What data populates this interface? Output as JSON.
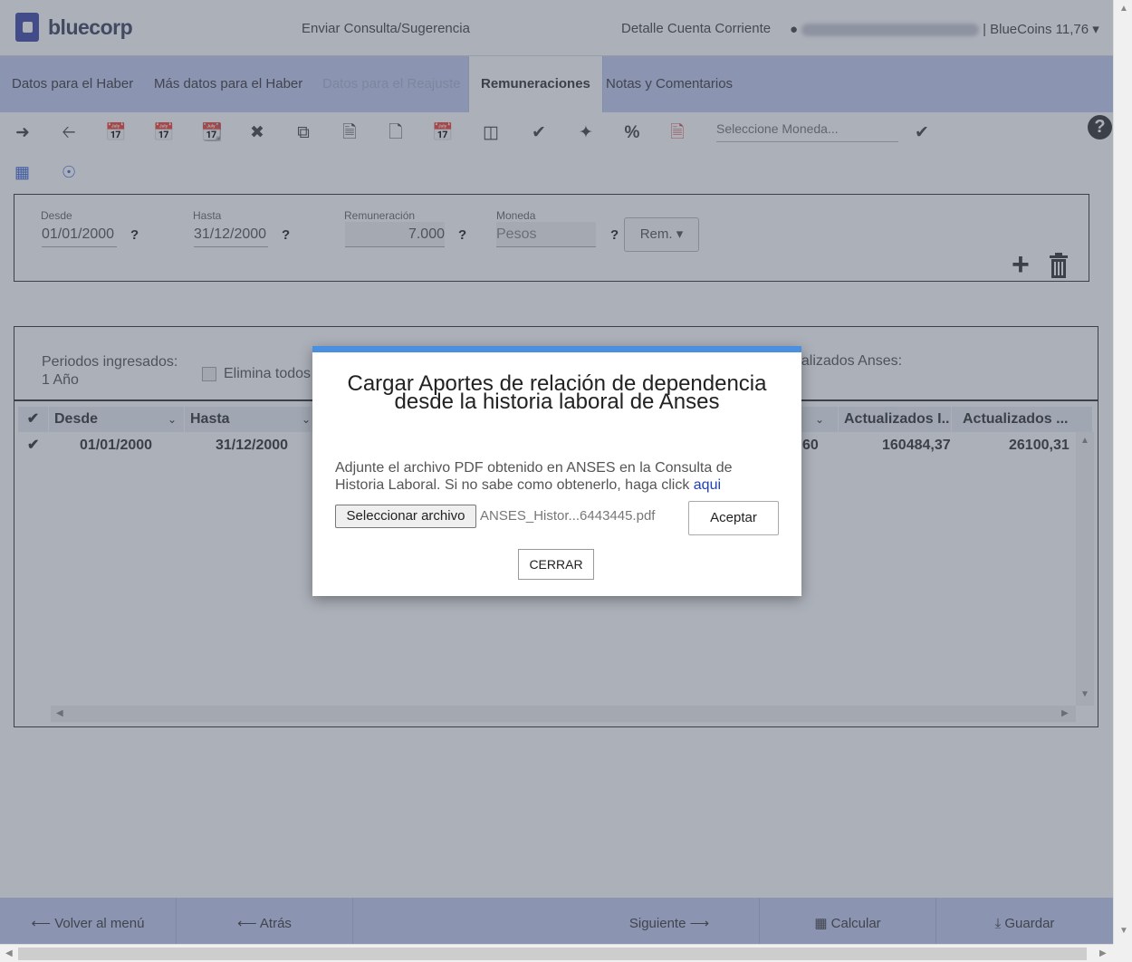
{
  "header": {
    "brand": "bluecorp",
    "consulta_link": "Enviar Consulta/Sugerencia",
    "cuenta_link": "Detalle Cuenta Corriente",
    "bluecoins": "| BlueCoins 11,76",
    "caret": "▾"
  },
  "tabs": [
    {
      "label": "Datos para el Haber"
    },
    {
      "label": "Más datos para el Haber"
    },
    {
      "label": "Datos para el Reajuste"
    },
    {
      "label": "Remuneraciones"
    },
    {
      "label": "Notas y Comentarios"
    }
  ],
  "toolbar": {
    "icons": [
      "arrow-right-icon",
      "arrow-left-icon",
      "calendar-plus-icon",
      "calendar-minus-icon",
      "calendar-icon",
      "times-icon",
      "copy-icon",
      "file-icon",
      "file-excel-icon",
      "calendar-times-icon",
      "money-icon",
      "check-circle-icon",
      "magic-wand-icon",
      "percent-icon",
      "file-pdf-icon"
    ],
    "moneda_placeholder": "Seleccione Moneda...",
    "help": "?"
  },
  "form": {
    "desde_label": "Desde",
    "desde_value": "01/01/2000",
    "hasta_label": "Hasta",
    "hasta_value": "31/12/2000",
    "rem_label": "Remuneración",
    "rem_value": "7.000",
    "moneda_label": "Moneda",
    "moneda_value": "Pesos",
    "q": "?",
    "rem_button": "Rem. ▾"
  },
  "grid": {
    "periods_label": "Periodos ingresados:",
    "periods_value": "1 Año",
    "elimina": "Elimina todos",
    "actualizados": "ualizados Anses:",
    "columns": [
      "Desde",
      "Hasta",
      "Actualizados I..",
      "Actualizados ..."
    ],
    "row": {
      "desde": "01/01/2000",
      "hasta": "31/12/2000",
      "partial": "60",
      "act1": "160484,37",
      "act2": "26100,31"
    }
  },
  "footer": {
    "volver": "⟵ Volver al menú",
    "atras": "⟵ Atrás",
    "siguiente": "Siguiente ⟶",
    "calcular": "Calcular",
    "guardar": "Guardar"
  },
  "modal": {
    "title": "Cargar Aportes de relación de dependencia desde la historia laboral de Anses",
    "text": "Adjunte el archivo PDF obtenido en ANSES en la Consulta de Historia Laboral. Si no sabe como obtenerlo, haga click",
    "link": "aqui",
    "file_button": "Seleccionar archivo",
    "file_name": "ANSES_Histor...6443445.pdf",
    "accept": "Aceptar",
    "close": "CERRAR"
  },
  "colors": {
    "accent": "#4a8fe0",
    "tabbar": "#c3cdf0",
    "brand": "#3f4aa8"
  }
}
